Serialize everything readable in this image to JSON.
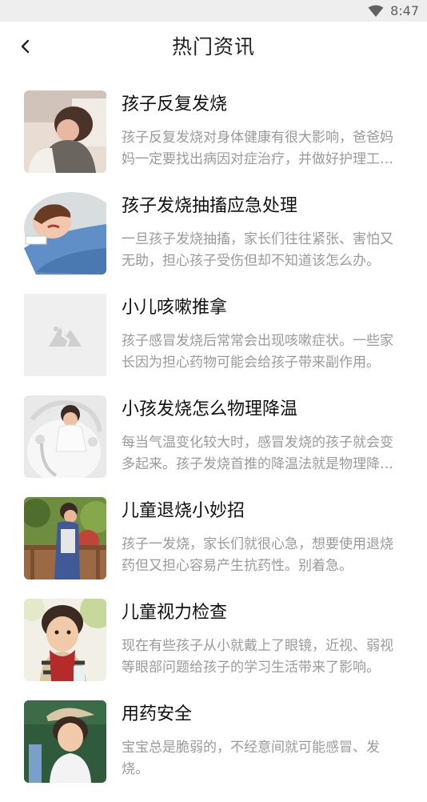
{
  "status_bar": {
    "time": "8:47",
    "icons": [
      "wifi-icon"
    ]
  },
  "header": {
    "title": "热门资讯",
    "back_icon": "chevron-left-icon"
  },
  "articles": [
    {
      "title": "孩子反复发烧",
      "description": "孩子反复发烧对身体健康有很大影响，爸爸妈妈一定要找出病因对症治疗，并做好护理工作。"
    },
    {
      "title": "孩子发烧抽搐应急处理",
      "description": "一旦孩子发烧抽搐，家长们往往紧张、害怕又无助，担心孩子受伤但却不知道该怎么办。"
    },
    {
      "title": "小儿咳嗽推拿",
      "description": "孩子感冒发烧后常常会出现咳嗽症状。一些家长因为担心药物可能会给孩子带来副作用。"
    },
    {
      "title": "小孩发烧怎么物理降温",
      "description": "每当气温变化较大时，感冒发烧的孩子就会变多起来。孩子发烧首推的降温法就是物理降温。"
    },
    {
      "title": "儿童退烧小妙招",
      "description": "孩子一发烧，家长们就很心急，想要使用退烧药但又担心容易产生抗药性。别着急。"
    },
    {
      "title": "儿童视力检查",
      "description": "现在有些孩子从小就戴上了眼镜，近视、弱视等眼部问题给孩子的学习生活带来了影响。"
    },
    {
      "title": "用药安全",
      "description": "宝宝总是脆弱的，不经意间就可能感冒、发烧。"
    }
  ]
}
